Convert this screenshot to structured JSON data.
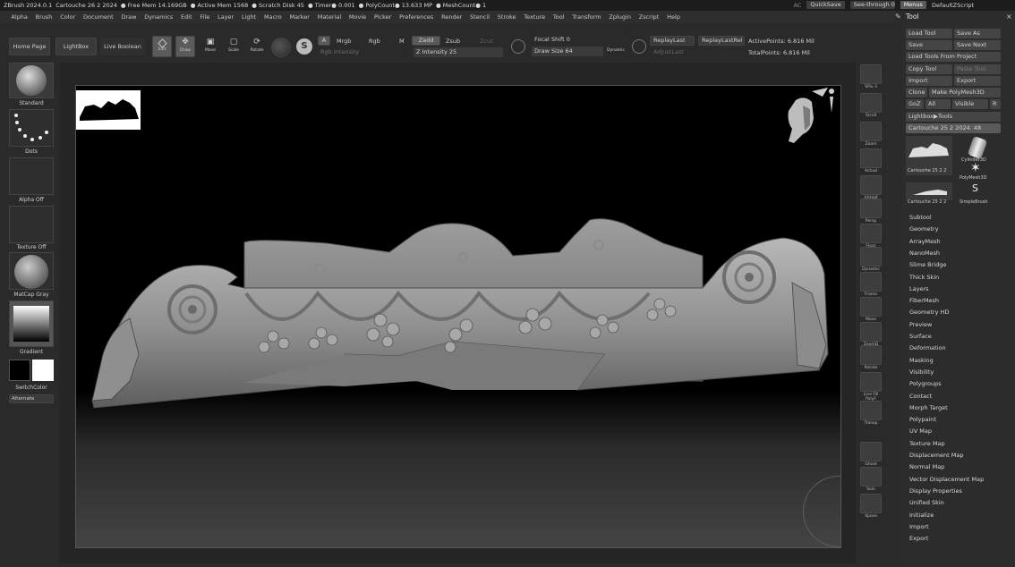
{
  "titlebar": {
    "app": "ZBrush 2024.0.1",
    "doc": "Cartouche 26 2 2024",
    "free_mem": "● Free Mem 14.169GB",
    "active_mem": "● Active Mem 1568",
    "scratch": "● Scratch Disk 45",
    "timer": "● Timer● 0.001",
    "polycount": "● PolyCount● 13.633 MP",
    "meshcount": "● MeshCount● 1",
    "ac": "AC",
    "quicksave": "QuickSave",
    "seethrough": "See-through  0",
    "menus": "Menus",
    "script": "DefaultZScript"
  },
  "menubar": [
    "Alpha",
    "Brush",
    "Color",
    "Document",
    "Draw",
    "Dynamics",
    "Edit",
    "File",
    "Layer",
    "Light",
    "Macro",
    "Marker",
    "Material",
    "Movie",
    "Picker",
    "Preferences",
    "Render",
    "Stencil",
    "Stroke",
    "Texture",
    "Tool",
    "Transform",
    "Zplugin",
    "Zscript",
    "Help"
  ],
  "toolbar": {
    "home": "Home Page",
    "lightbox": "LightBox",
    "liveboolean": "Live Boolean",
    "edit": "Edit",
    "draw": "Draw",
    "move": "Move",
    "scale": "Scale",
    "rotate": "Rotate",
    "a": "A",
    "mrgb": "Mrgb",
    "rgb": "Rgb",
    "m": "M",
    "zadd": "Zadd",
    "zsub": "Zsub",
    "zcut": "Zcut",
    "rgb_intensity": "Rgb Intensity",
    "z_intensity": "Z Intensity 25",
    "focal_shift": "Focal Shift 0",
    "draw_size": "Draw Size 64",
    "dynamic": "Dynamic",
    "replaylast": "ReplayLast",
    "replaylastrel": "ReplayLastRel",
    "adjustlast": "AdjustLast",
    "activepoints": "ActivePoints: 6.816 Mil",
    "totalpoints": "TotalPoints: 6.816 Mil"
  },
  "leftshelf": {
    "brush": "Standard",
    "stroke": "Dots",
    "alpha": "Alpha Off",
    "texture": "Texture Off",
    "material": "MatCap Gray",
    "gradient": "Gradient",
    "switchcolor": "SwitchColor",
    "alternate": "Alternate"
  },
  "rightshelf": [
    "SPix 3",
    "Scroll",
    "Zoom",
    "Actual",
    "AAHalf",
    "Persp",
    "Floor",
    "Dynamic",
    "Frame",
    "Move",
    "ZoomD",
    "Rotate",
    "Line Fill PolyF",
    "Transp",
    "Ghost",
    "Solo",
    "Xpose"
  ],
  "toolpanel": {
    "title": "Tool",
    "load_tool": "Load Tool",
    "save_as": "Save As",
    "save": "Save",
    "save_next": "Save Next",
    "load_from_project": "Load Tools From Project",
    "copy_tool": "Copy Tool",
    "paste_tool": "Paste Tool",
    "import": "Import",
    "export": "Export",
    "clone": "Clone",
    "make_polymesh": "Make PolyMesh3D",
    "goz": "GoZ",
    "all": "All",
    "visible": "Visible",
    "r": "R",
    "lightbox_tools": "Lightbox▶Tools",
    "current_tool": "Cartouche 25 2 2024. 48",
    "thumbs": [
      "Cartouche 25 2 2",
      "Cylinder3D",
      "Cartouche 25 2 2",
      "PolyMesh3D",
      "SimpleBrush"
    ],
    "subpalettes": [
      "Subtool",
      "Geometry",
      "ArrayMesh",
      "NanoMesh",
      "Slime Bridge",
      "Thick Skin",
      "Layers",
      "FiberMesh",
      "Geometry HD",
      "Preview",
      "Surface",
      "Deformation",
      "Masking",
      "Visibility",
      "Polygroups",
      "Contact",
      "Morph Target",
      "Polypaint",
      "UV Map",
      "Texture Map",
      "Displacement Map",
      "Normal Map",
      "Vector Displacement Map",
      "Display Properties",
      "Unified Skin",
      "Initialize",
      "Import",
      "Export"
    ]
  }
}
